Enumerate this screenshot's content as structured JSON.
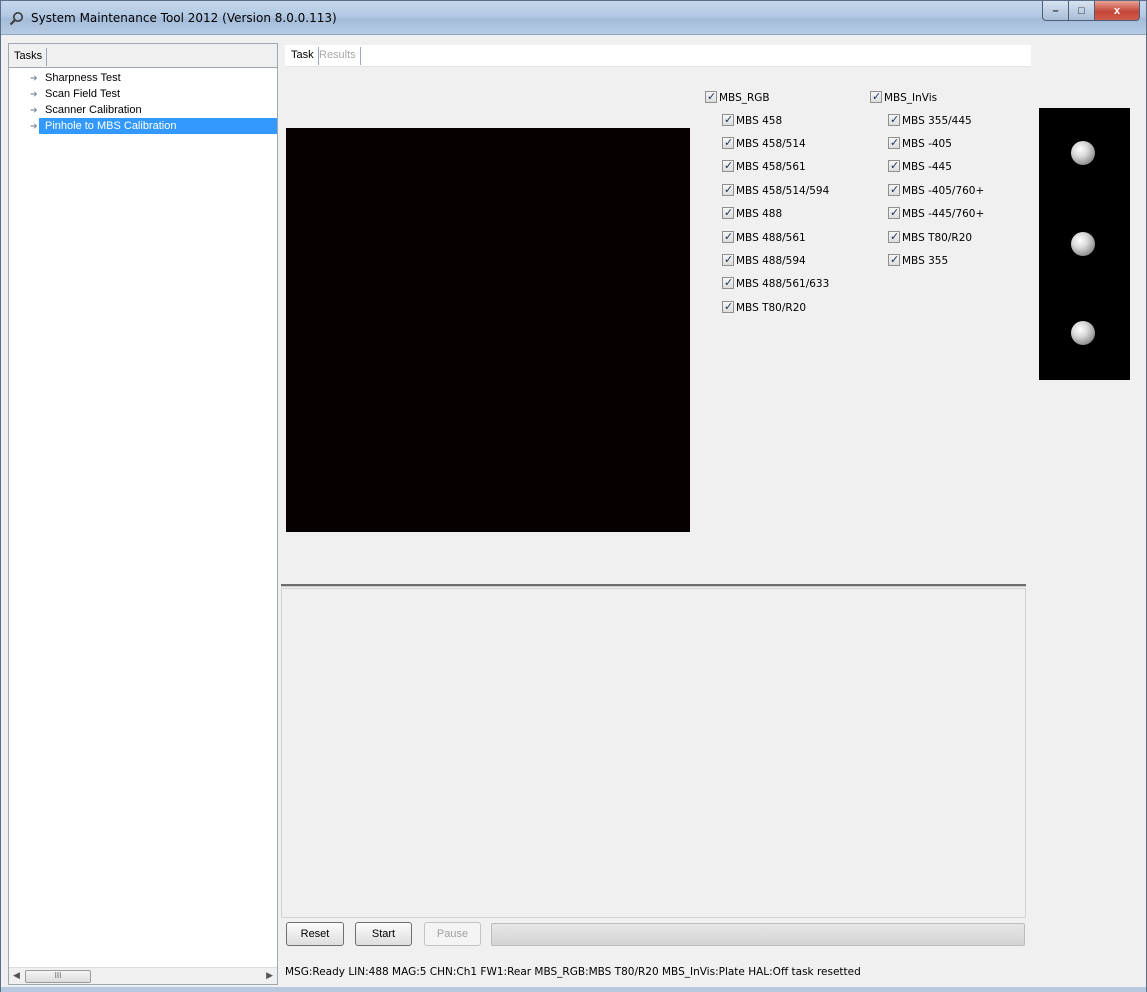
{
  "window": {
    "title": "System Maintenance Tool 2012 (Version 8.0.0.113)",
    "controls": {
      "minimize": "–",
      "maximize": "□",
      "close": "x"
    }
  },
  "left_panel": {
    "tabs": [
      "Tasks"
    ],
    "tasks": [
      {
        "label": "Sharpness Test",
        "selected": false
      },
      {
        "label": "Scan Field Test",
        "selected": false
      },
      {
        "label": "Scanner Calibration",
        "selected": false
      },
      {
        "label": "Pinhole to MBS Calibration",
        "selected": true
      }
    ],
    "scrollbar_thumb": "III"
  },
  "right_panel": {
    "tabs": [
      {
        "label": "Task",
        "active": true
      },
      {
        "label": "Results",
        "active": false
      }
    ]
  },
  "mbs_rgb": {
    "header": "MBS_RGB",
    "items": [
      "MBS 458",
      "MBS 458/514",
      "MBS 458/561",
      "MBS 458/514/594",
      "MBS 488",
      "MBS 488/561",
      "MBS 488/594",
      "MBS 488/561/633",
      "MBS T80/R20"
    ]
  },
  "mbs_invis": {
    "header": "MBS_InVis",
    "items": [
      "MBS 355/445",
      "MBS -405",
      "MBS -445",
      "MBS -405/760+",
      "MBS -445/760+",
      "MBS T80/R20",
      "MBS 355"
    ]
  },
  "buttons": {
    "reset": "Reset",
    "start": "Start",
    "pause": "Pause"
  },
  "statusbar": "MSG:Ready  LIN:488  MAG:5  CHN:Ch1  FW1:Rear  MBS_RGB:MBS T80/R20  MBS_InVis:Plate  HAL:Off  task resetted",
  "colors": {
    "selection": "#3399ff",
    "view_background": "#070000"
  }
}
